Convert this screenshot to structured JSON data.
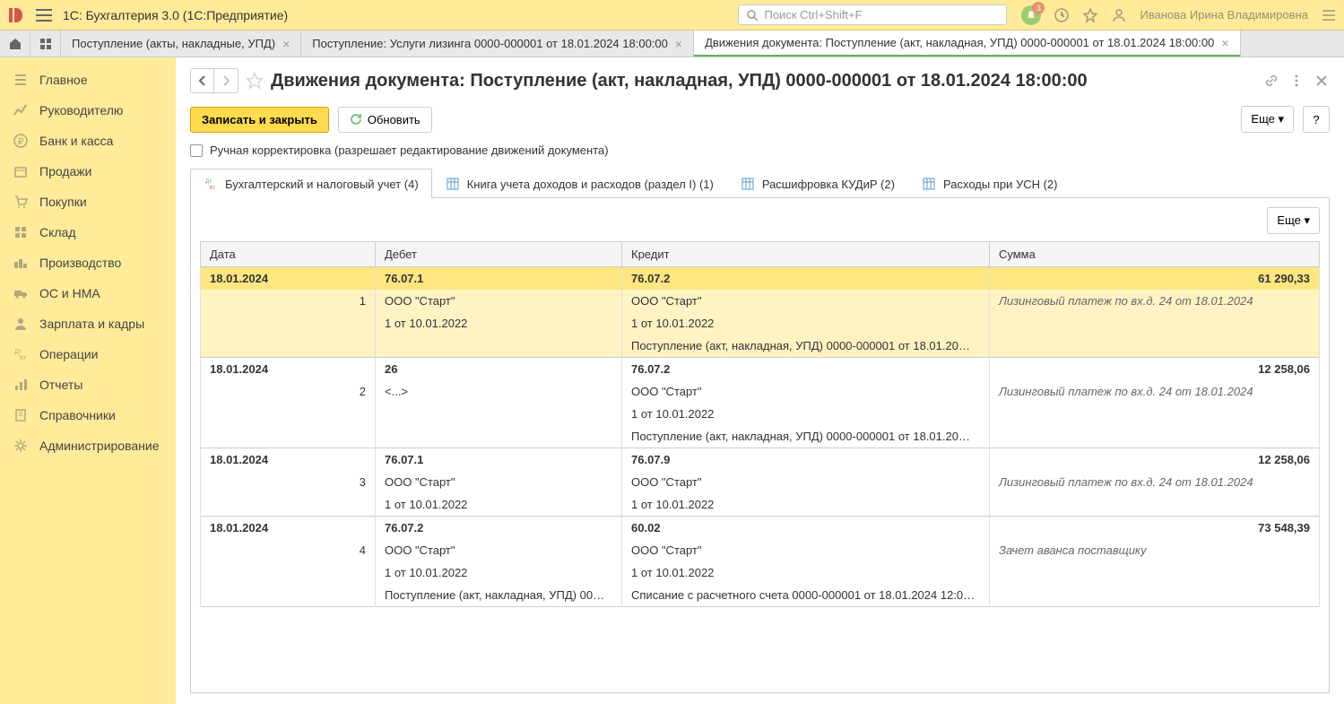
{
  "header": {
    "app_title": "1С: Бухгалтерия 3.0  (1С:Предприятие)",
    "search_placeholder": "Поиск Ctrl+Shift+F",
    "notification_count": "3",
    "user_name": "Иванова Ирина Владимировна"
  },
  "tabs": [
    {
      "label": "Поступление (акты, накладные, УПД)"
    },
    {
      "label": "Поступление: Услуги лизинга 0000-000001 от 18.01.2024 18:00:00"
    },
    {
      "label": "Движения документа: Поступление (акт, накладная, УПД) 0000-000001 от 18.01.2024 18:00:00"
    }
  ],
  "sidebar": {
    "items": [
      {
        "label": "Главное"
      },
      {
        "label": "Руководителю"
      },
      {
        "label": "Банк и касса"
      },
      {
        "label": "Продажи"
      },
      {
        "label": "Покупки"
      },
      {
        "label": "Склад"
      },
      {
        "label": "Производство"
      },
      {
        "label": "ОС и НМА"
      },
      {
        "label": "Зарплата и кадры"
      },
      {
        "label": "Операции"
      },
      {
        "label": "Отчеты"
      },
      {
        "label": "Справочники"
      },
      {
        "label": "Администрирование"
      }
    ]
  },
  "page": {
    "title": "Движения документа: Поступление (акт, накладная, УПД) 0000-000001 от 18.01.2024 18:00:00"
  },
  "toolbar": {
    "save_close": "Записать и закрыть",
    "refresh": "Обновить",
    "more": "Еще",
    "help": "?"
  },
  "checkbox_label": "Ручная корректировка (разрешает редактирование движений документа)",
  "content_tabs": [
    {
      "label": "Бухгалтерский и налоговый учет (4)"
    },
    {
      "label": "Книга учета доходов и расходов (раздел I) (1)"
    },
    {
      "label": "Расшифровка КУДиР (2)"
    },
    {
      "label": "Расходы при УСН (2)"
    }
  ],
  "table_more": "Еще",
  "table": {
    "headers": {
      "date": "Дата",
      "debit": "Дебет",
      "credit": "Кредит",
      "sum": "Сумма"
    },
    "rows": [
      {
        "date": "18.01.2024",
        "num": "1",
        "debit_acct": "76.07.1",
        "debit_sub1": "ООО \"Старт\"",
        "debit_sub2": "1 от 10.01.2022",
        "debit_sub3": "",
        "credit_acct": "76.07.2",
        "credit_sub1": "ООО \"Старт\"",
        "credit_sub2": "1 от 10.01.2022",
        "credit_sub3": "Поступление (акт, накладная, УПД) 0000-000001 от 18.01.20…",
        "sum": "61 290,33",
        "desc": "Лизинговый платеж по вх.д. 24 от 18.01.2024",
        "selected": true
      },
      {
        "date": "18.01.2024",
        "num": "2",
        "debit_acct": "26",
        "debit_sub1": "<...>",
        "debit_sub2": "",
        "debit_sub3": "",
        "credit_acct": "76.07.2",
        "credit_sub1": "ООО \"Старт\"",
        "credit_sub2": "1 от 10.01.2022",
        "credit_sub3": "Поступление (акт, накладная, УПД) 0000-000001 от 18.01.20…",
        "sum": "12 258,06",
        "desc": "Лизинговый платеж по вх.д. 24 от 18.01.2024"
      },
      {
        "date": "18.01.2024",
        "num": "3",
        "debit_acct": "76.07.1",
        "debit_sub1": "ООО \"Старт\"",
        "debit_sub2": "1 от 10.01.2022",
        "debit_sub3": "",
        "credit_acct": "76.07.9",
        "credit_sub1": "ООО \"Старт\"",
        "credit_sub2": "1 от 10.01.2022",
        "credit_sub3": "",
        "sum": "12 258,06",
        "desc": "Лизинговый платеж по вх.д. 24 от 18.01.2024"
      },
      {
        "date": "18.01.2024",
        "num": "4",
        "debit_acct": "76.07.2",
        "debit_sub1": "ООО \"Старт\"",
        "debit_sub2": "1 от 10.01.2022",
        "debit_sub3": "Поступление (акт, накладная, УПД) 00…",
        "credit_acct": "60.02",
        "credit_sub1": "ООО \"Старт\"",
        "credit_sub2": "1 от 10.01.2022",
        "credit_sub3": "Списание с расчетного счета 0000-000001 от 18.01.2024 12:0…",
        "sum": "73 548,39",
        "desc": "Зачет аванса поставщику"
      }
    ]
  }
}
